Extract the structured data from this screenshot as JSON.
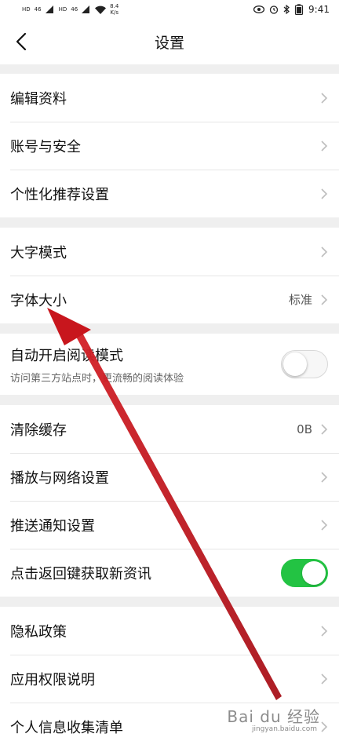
{
  "status_bar": {
    "left_badges": [
      "HD",
      "HD"
    ],
    "signal_labels": [
      "46",
      "46"
    ],
    "net_speed": "8.4",
    "net_speed_unit": "K/s",
    "time": "9:41"
  },
  "header": {
    "title": "设置"
  },
  "groups": [
    {
      "items": [
        {
          "label": "编辑资料"
        },
        {
          "label": "账号与安全"
        },
        {
          "label": "个性化推荐设置"
        }
      ]
    },
    {
      "items": [
        {
          "label": "大字模式"
        },
        {
          "label": "字体大小",
          "value": "标准"
        }
      ]
    },
    {
      "items": [
        {
          "label": "自动开启阅读模式",
          "subtitle": "访问第三方站点时，更流畅的阅读体验",
          "toggle": false
        }
      ]
    },
    {
      "items": [
        {
          "label": "清除缓存",
          "value": "0B"
        },
        {
          "label": "播放与网络设置"
        },
        {
          "label": "推送通知设置"
        },
        {
          "label": "点击返回键获取新资讯",
          "toggle": true
        }
      ]
    },
    {
      "items": [
        {
          "label": "隐私政策"
        },
        {
          "label": "应用权限说明"
        },
        {
          "label": "个人信息收集清单"
        }
      ]
    }
  ],
  "watermark": {
    "brand": "Bai du 经验",
    "url": "jingyan.baidu.com"
  },
  "colors": {
    "toggle_on": "#23c343",
    "arrow": "#c8161d",
    "group_gap": "#efefef"
  }
}
